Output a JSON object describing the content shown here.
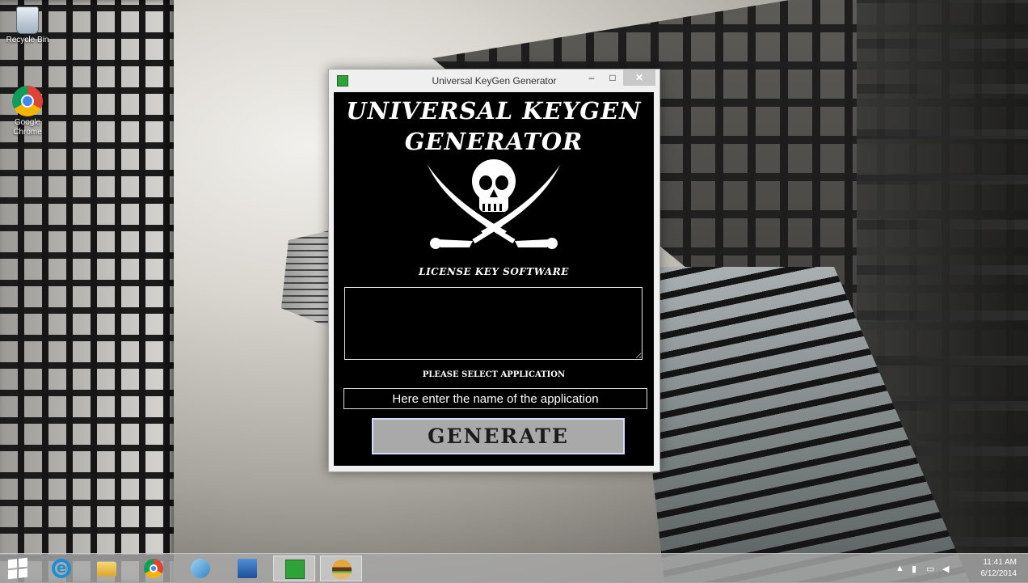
{
  "desktop": {
    "icons": [
      {
        "label": "Recycle Bin",
        "icon": "recycle-bin-icon"
      },
      {
        "label": "Google Chrome",
        "icon": "chrome-icon"
      }
    ]
  },
  "window": {
    "title": "Universal KeyGen Generator",
    "minimize_glyph": "–",
    "maximize_glyph": "□",
    "close_glyph": "✕"
  },
  "app": {
    "heading_line1": "UNIVERSAL KEYGEN",
    "heading_line2": "GENERATOR",
    "logo_icon": "skull-crossed-swords-icon",
    "logo_caption": "LICENSE KEY SOFTWARE",
    "output_value": "",
    "select_label": "PLEASE SELECT APPLICATION",
    "app_name_placeholder": "Here enter the name of the application",
    "generate_label": "GENERATE"
  },
  "taskbar": {
    "items": [
      {
        "icon": "windows-start-icon"
      },
      {
        "icon": "internet-explorer-icon"
      },
      {
        "icon": "file-explorer-icon"
      },
      {
        "icon": "chrome-icon"
      },
      {
        "icon": "paint-icon"
      },
      {
        "icon": "remote-desktop-icon"
      },
      {
        "icon": "keygen-app-icon",
        "active": true
      },
      {
        "icon": "burger-app-icon",
        "active": true
      }
    ],
    "tray": {
      "time": "11:41 AM",
      "date": "6/12/2014"
    }
  },
  "colors": {
    "window_body": "#000000",
    "text": "#ffffff",
    "generate_button": "#a9a9a9",
    "generate_border": "#d7dcff"
  }
}
